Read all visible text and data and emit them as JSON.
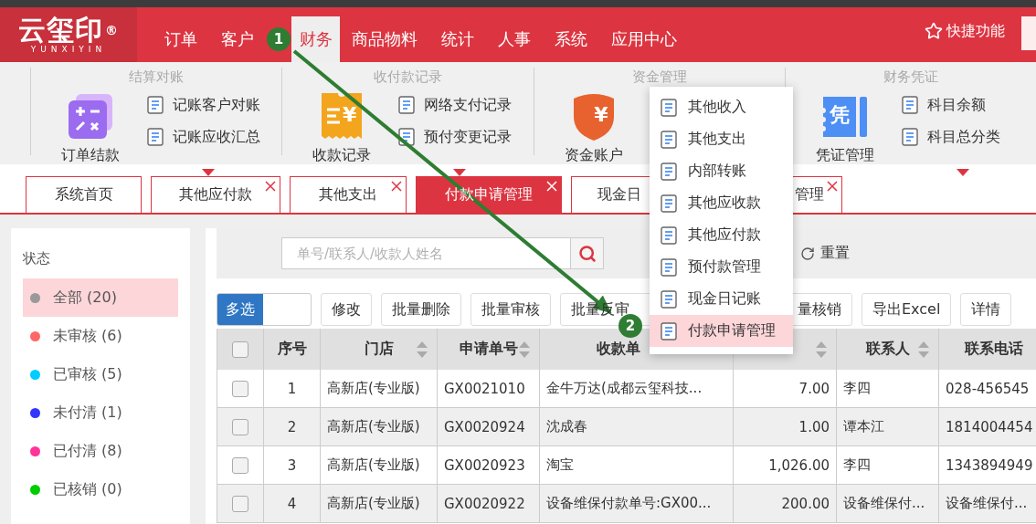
{
  "logo": {
    "name": "云玺印",
    "mark": "®",
    "sub": "YUNXIYIN"
  },
  "nav": [
    {
      "label": "订单",
      "selected": false
    },
    {
      "label": "客户",
      "selected": false
    },
    {
      "label": "财务",
      "selected": true
    },
    {
      "label": "商品物料",
      "selected": false
    },
    {
      "label": "统计",
      "selected": false
    },
    {
      "label": "人事",
      "selected": false
    },
    {
      "label": "系统",
      "selected": false
    },
    {
      "label": "应用中心",
      "selected": false
    }
  ],
  "quick_access": {
    "label": "快捷功能"
  },
  "ribbon": [
    {
      "title": "结算对账",
      "main": {
        "kind": "calculator",
        "label": "订单结款"
      },
      "items": [
        "记账客户对账",
        "记账应收汇总"
      ]
    },
    {
      "title": "收付款记录",
      "main": {
        "kind": "receipt",
        "label": "收款记录",
        "glyph": "¥"
      },
      "items": [
        "网络支付记录",
        "预付变更记录"
      ]
    },
    {
      "title": "资金管理",
      "main": {
        "kind": "shield",
        "label": "资金账户",
        "glyph": "¥"
      }
    },
    {
      "title": "财务凭证",
      "main": {
        "kind": "voucher",
        "label": "凭证管理",
        "glyph": "凭"
      },
      "items": [
        "科目余额",
        "科目总分类"
      ]
    }
  ],
  "tabs": [
    {
      "label": "系统首页",
      "selected": false,
      "closable": false
    },
    {
      "label": "其他应付款",
      "selected": false,
      "closable": true
    },
    {
      "label": "其他支出",
      "selected": false,
      "closable": true
    },
    {
      "label": "付款申请管理",
      "selected": true,
      "closable": true
    },
    {
      "label": "现金日",
      "selected": false,
      "closable": false
    },
    {
      "label": "管理",
      "selected": false,
      "closable": true
    }
  ],
  "sidebar": {
    "title": "状态",
    "items": [
      {
        "label": "全部 (20)",
        "color": "#999999",
        "selected": true
      },
      {
        "label": "未审核 (6)",
        "color": "#ff6666",
        "selected": false
      },
      {
        "label": "已审核 (5)",
        "color": "#00ccff",
        "selected": false
      },
      {
        "label": "未付清 (1)",
        "color": "#3333ff",
        "selected": false
      },
      {
        "label": "已付清 (8)",
        "color": "#ff3399",
        "selected": false
      },
      {
        "label": "已核销 (0)",
        "color": "#00cc00",
        "selected": false
      }
    ]
  },
  "search": {
    "placeholder": "单号/联系人/收款人姓名",
    "reset": "重置"
  },
  "toolbar": {
    "multi_select": {
      "label": "多选",
      "on": true
    },
    "buttons": [
      "修改",
      "批量删除",
      "批量审核",
      "批量反审",
      "量核销",
      "导出Excel",
      "详情"
    ]
  },
  "table": {
    "select_all": {
      "checked": false
    },
    "columns": [
      {
        "label": "序号",
        "sortable": false
      },
      {
        "label": "门店",
        "sortable": true
      },
      {
        "label": "申请单号",
        "sortable": true
      },
      {
        "label": "收款单",
        "sortable": false
      },
      {
        "sortable": true
      },
      {
        "label": "联系人",
        "sortable": true
      },
      {
        "label": "联系电话",
        "sortable": false
      }
    ],
    "rows": [
      {
        "checked": false,
        "cells": [
          "1",
          "高新店(专业版)",
          "GX0021010",
          "金牛万达(成都云玺科技...",
          "7.00",
          "李四",
          "028-456545"
        ]
      },
      {
        "checked": false,
        "cells": [
          "2",
          "高新店(专业版)",
          "GX0020924",
          "沈成春",
          "1.00",
          "谭本江",
          "1814004454"
        ]
      },
      {
        "checked": false,
        "cells": [
          "3",
          "高新店(专业版)",
          "GX0020923",
          "淘宝",
          "1,026.00",
          "李四",
          "1343894949"
        ]
      },
      {
        "checked": false,
        "cells": [
          "4",
          "高新店(专业版)",
          "GX0020922",
          "设备维保付款单号:GX00...",
          "200.00",
          "设备维保付...",
          "设备维保付..."
        ]
      }
    ]
  },
  "menu": {
    "items": [
      {
        "label": "其他收入",
        "selected": false
      },
      {
        "label": "其他支出",
        "selected": false
      },
      {
        "label": "内部转账",
        "selected": false
      },
      {
        "label": "其他应收款",
        "selected": false
      },
      {
        "label": "其他应付款",
        "selected": false
      },
      {
        "label": "预付款管理",
        "selected": false
      },
      {
        "label": "现金日记账",
        "selected": false
      },
      {
        "label": "付款申请管理",
        "selected": true
      }
    ]
  },
  "annotations": [
    {
      "label": "1"
    },
    {
      "label": "2"
    }
  ]
}
